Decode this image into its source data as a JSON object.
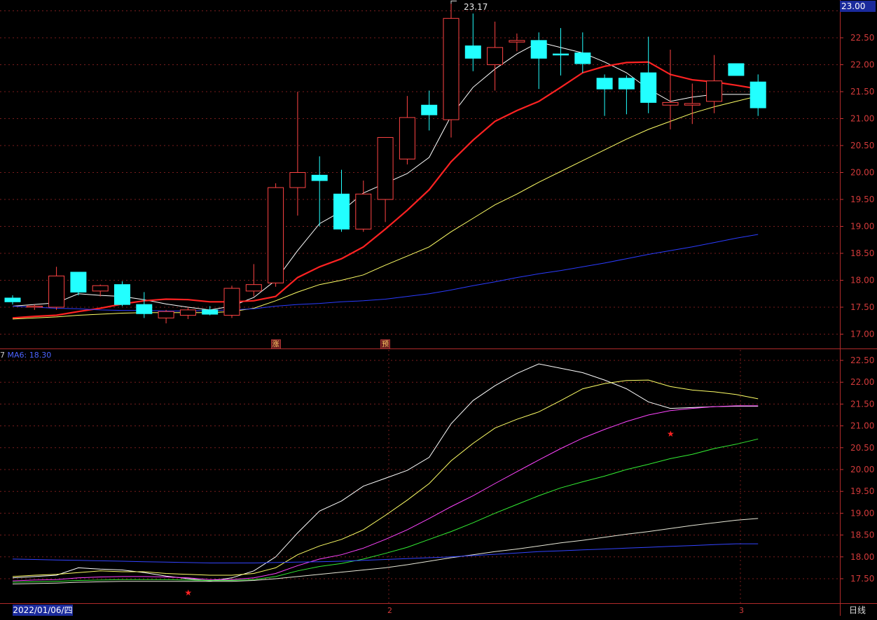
{
  "chart_data": [
    {
      "type": "candlestick",
      "ylim": [
        16.8,
        23.2
      ],
      "y_ticks": [
        "23.00",
        "22.50",
        "22.00",
        "21.50",
        "21.00",
        "20.50",
        "20.00",
        "19.50",
        "19.00",
        "18.50",
        "18.00",
        "17.50",
        "17.00"
      ],
      "y_tick_values": [
        23.0,
        22.5,
        22.0,
        21.5,
        21.0,
        20.5,
        20.0,
        19.5,
        19.0,
        18.5,
        18.0,
        17.5,
        17.0
      ],
      "high_label": "23.17",
      "current_price_tag": "23.00",
      "markers": [
        {
          "text": "涨",
          "index": 12
        },
        {
          "text": "预",
          "index": 17
        }
      ],
      "candles": [
        {
          "o": 17.67,
          "h": 17.72,
          "l": 17.55,
          "c": 17.6
        },
        {
          "o": 17.5,
          "h": 17.55,
          "l": 17.45,
          "c": 17.52
        },
        {
          "o": 17.5,
          "h": 18.25,
          "l": 17.45,
          "c": 18.08
        },
        {
          "o": 18.15,
          "h": 18.15,
          "l": 17.72,
          "c": 17.78
        },
        {
          "o": 17.8,
          "h": 17.92,
          "l": 17.7,
          "c": 17.9
        },
        {
          "o": 17.92,
          "h": 17.98,
          "l": 17.52,
          "c": 17.55
        },
        {
          "o": 17.55,
          "h": 17.78,
          "l": 17.3,
          "c": 17.38
        },
        {
          "o": 17.3,
          "h": 17.45,
          "l": 17.2,
          "c": 17.42
        },
        {
          "o": 17.35,
          "h": 17.5,
          "l": 17.28,
          "c": 17.45
        },
        {
          "o": 17.45,
          "h": 17.52,
          "l": 17.35,
          "c": 17.37
        },
        {
          "o": 17.35,
          "h": 17.9,
          "l": 17.3,
          "c": 17.85
        },
        {
          "o": 17.8,
          "h": 18.3,
          "l": 17.7,
          "c": 17.92
        },
        {
          "o": 17.95,
          "h": 19.8,
          "l": 17.88,
          "c": 19.72
        },
        {
          "o": 19.72,
          "h": 21.5,
          "l": 19.2,
          "c": 20.0
        },
        {
          "o": 19.95,
          "h": 20.3,
          "l": 19.0,
          "c": 19.85
        },
        {
          "o": 19.6,
          "h": 20.05,
          "l": 18.9,
          "c": 18.95
        },
        {
          "o": 18.95,
          "h": 19.85,
          "l": 18.9,
          "c": 19.6
        },
        {
          "o": 19.5,
          "h": 20.65,
          "l": 19.08,
          "c": 20.65
        },
        {
          "o": 20.25,
          "h": 21.42,
          "l": 20.15,
          "c": 21.02
        },
        {
          "o": 21.25,
          "h": 21.52,
          "l": 20.78,
          "c": 21.07
        },
        {
          "o": 20.98,
          "h": 23.17,
          "l": 20.65,
          "c": 22.86
        },
        {
          "o": 22.35,
          "h": 22.95,
          "l": 21.88,
          "c": 22.12
        },
        {
          "o": 22.0,
          "h": 22.8,
          "l": 21.52,
          "c": 22.32
        },
        {
          "o": 22.42,
          "h": 22.58,
          "l": 22.25,
          "c": 22.45
        },
        {
          "o": 22.45,
          "h": 22.6,
          "l": 21.55,
          "c": 22.12
        },
        {
          "o": 22.2,
          "h": 22.68,
          "l": 21.8,
          "c": 22.18
        },
        {
          "o": 22.22,
          "h": 22.6,
          "l": 21.85,
          "c": 22.02
        },
        {
          "o": 21.75,
          "h": 21.82,
          "l": 21.05,
          "c": 21.55
        },
        {
          "o": 21.75,
          "h": 21.8,
          "l": 21.08,
          "c": 21.55
        },
        {
          "o": 21.85,
          "h": 22.52,
          "l": 21.1,
          "c": 21.3
        },
        {
          "o": 21.25,
          "h": 22.28,
          "l": 20.8,
          "c": 21.3
        },
        {
          "o": 21.25,
          "h": 21.65,
          "l": 20.9,
          "c": 21.28
        },
        {
          "o": 21.32,
          "h": 22.18,
          "l": 21.1,
          "c": 21.7
        },
        {
          "o": 22.02,
          "h": 22.02,
          "l": 21.8,
          "c": 21.8
        },
        {
          "o": 21.68,
          "h": 21.82,
          "l": 21.05,
          "c": 21.2
        }
      ],
      "lines": [
        {
          "color": "#ffffff",
          "values": [
            17.52,
            17.55,
            17.58,
            17.75,
            17.72,
            17.7,
            17.64,
            17.56,
            17.5,
            17.45,
            17.52,
            17.68,
            18.0,
            18.55,
            19.05,
            19.28,
            19.62,
            19.8,
            19.98,
            20.28,
            21.05,
            21.58,
            21.92,
            22.2,
            22.42,
            22.32,
            22.22,
            22.05,
            21.85,
            21.55,
            21.32,
            21.4,
            21.45,
            21.45,
            21.45
          ]
        },
        {
          "color": "#ff2222",
          "values": [
            17.3,
            17.33,
            17.35,
            17.42,
            17.48,
            17.56,
            17.62,
            17.65,
            17.64,
            17.6,
            17.6,
            17.62,
            17.7,
            18.05,
            18.25,
            18.4,
            18.62,
            18.95,
            19.3,
            19.68,
            20.2,
            20.6,
            20.95,
            21.15,
            21.32,
            21.58,
            21.85,
            21.97,
            22.04,
            22.05,
            21.82,
            21.72,
            21.68,
            21.62,
            21.55
          ]
        },
        {
          "color": "#ffff66",
          "values": [
            17.28,
            17.3,
            17.32,
            17.35,
            17.37,
            17.39,
            17.4,
            17.4,
            17.4,
            17.4,
            17.42,
            17.48,
            17.62,
            17.78,
            17.92,
            18.0,
            18.1,
            18.28,
            18.45,
            18.62,
            18.9,
            19.15,
            19.4,
            19.6,
            19.82,
            20.02,
            20.22,
            20.42,
            20.62,
            20.8,
            20.95,
            21.1,
            21.22,
            21.32,
            21.42
          ]
        },
        {
          "color": "#2b3cff",
          "values": [
            17.52,
            17.5,
            17.48,
            17.47,
            17.45,
            17.44,
            17.44,
            17.43,
            17.43,
            17.44,
            17.45,
            17.47,
            17.52,
            17.55,
            17.57,
            17.6,
            17.62,
            17.65,
            17.7,
            17.75,
            17.82,
            17.9,
            17.97,
            18.05,
            18.12,
            18.18,
            18.25,
            18.32,
            18.4,
            18.48,
            18.55,
            18.62,
            18.7,
            18.78,
            18.85
          ]
        }
      ]
    },
    {
      "type": "line",
      "label_key": "MA6:",
      "label_value": "18.30",
      "ylim": [
        17.05,
        22.75
      ],
      "y_ticks": [
        "22.50",
        "22.00",
        "21.50",
        "21.00",
        "20.50",
        "20.00",
        "19.50",
        "19.00",
        "18.50",
        "18.00",
        "17.50"
      ],
      "y_tick_values": [
        22.5,
        22.0,
        21.5,
        21.0,
        20.5,
        20.0,
        19.5,
        19.0,
        18.5,
        18.0,
        17.5
      ],
      "markers": [
        {
          "text": "★",
          "index": 8,
          "value": 17.18
        },
        {
          "text": "★",
          "index": 30,
          "value": 20.82
        }
      ],
      "x_labels": [
        "2022/01/06/四",
        "2",
        "3"
      ],
      "series": [
        {
          "color": "#ffffff",
          "values": [
            17.52,
            17.55,
            17.58,
            17.75,
            17.72,
            17.7,
            17.64,
            17.56,
            17.5,
            17.45,
            17.52,
            17.68,
            18.0,
            18.55,
            19.05,
            19.28,
            19.62,
            19.8,
            19.98,
            20.28,
            21.05,
            21.58,
            21.92,
            22.2,
            22.42,
            22.32,
            22.22,
            22.05,
            21.85,
            21.55,
            21.4,
            21.42,
            21.44,
            21.45,
            21.45
          ]
        },
        {
          "color": "#ffff66",
          "values": [
            17.55,
            17.58,
            17.6,
            17.64,
            17.68,
            17.66,
            17.66,
            17.62,
            17.6,
            17.58,
            17.58,
            17.62,
            17.75,
            18.05,
            18.25,
            18.4,
            18.62,
            18.95,
            19.3,
            19.68,
            20.2,
            20.6,
            20.95,
            21.15,
            21.32,
            21.58,
            21.85,
            21.97,
            22.04,
            22.05,
            21.9,
            21.82,
            21.78,
            21.72,
            21.62
          ]
        },
        {
          "color": "#ff44ff",
          "values": [
            17.45,
            17.47,
            17.48,
            17.52,
            17.54,
            17.55,
            17.55,
            17.54,
            17.52,
            17.48,
            17.48,
            17.52,
            17.62,
            17.8,
            17.95,
            18.05,
            18.2,
            18.4,
            18.62,
            18.88,
            19.15,
            19.4,
            19.68,
            19.95,
            20.22,
            20.48,
            20.72,
            20.92,
            21.1,
            21.25,
            21.35,
            21.4,
            21.44,
            21.46,
            21.46
          ]
        },
        {
          "color": "#33ee33",
          "values": [
            17.42,
            17.43,
            17.44,
            17.46,
            17.47,
            17.48,
            17.48,
            17.48,
            17.47,
            17.46,
            17.46,
            17.48,
            17.55,
            17.68,
            17.78,
            17.85,
            17.95,
            18.08,
            18.22,
            18.4,
            18.58,
            18.78,
            19.0,
            19.2,
            19.4,
            19.58,
            19.72,
            19.85,
            20.0,
            20.12,
            20.25,
            20.35,
            20.48,
            20.58,
            20.7
          ]
        },
        {
          "color": "#e8e8d8",
          "values": [
            17.38,
            17.39,
            17.4,
            17.42,
            17.43,
            17.44,
            17.44,
            17.44,
            17.44,
            17.44,
            17.44,
            17.46,
            17.5,
            17.55,
            17.6,
            17.65,
            17.7,
            17.75,
            17.82,
            17.9,
            17.98,
            18.05,
            18.12,
            18.18,
            18.25,
            18.32,
            18.38,
            18.45,
            18.52,
            18.58,
            18.65,
            18.72,
            18.78,
            18.84,
            18.88
          ]
        },
        {
          "color": "#3344ff",
          "values": [
            17.95,
            17.94,
            17.93,
            17.92,
            17.91,
            17.9,
            17.89,
            17.88,
            17.87,
            17.86,
            17.86,
            17.86,
            17.87,
            17.88,
            17.89,
            17.9,
            17.92,
            17.94,
            17.96,
            17.98,
            18.0,
            18.03,
            18.06,
            18.09,
            18.12,
            18.14,
            18.16,
            18.18,
            18.2,
            18.22,
            18.24,
            18.26,
            18.28,
            18.3,
            18.3
          ]
        }
      ]
    }
  ],
  "footer": {
    "period_label": "日线"
  }
}
